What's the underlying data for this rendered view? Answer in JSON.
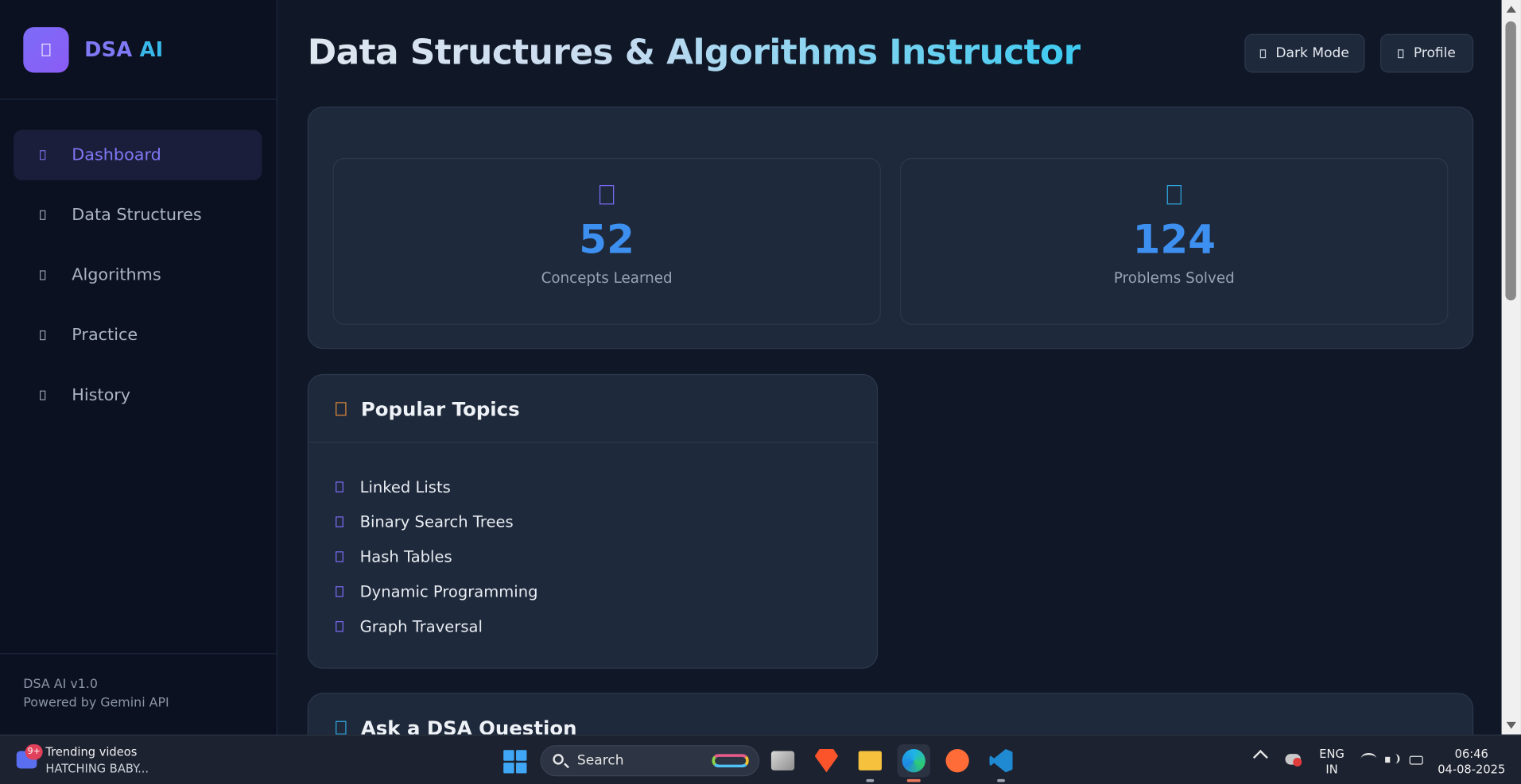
{
  "brand": {
    "name": "DSA",
    "name_accent": "AI"
  },
  "nav": {
    "items": [
      {
        "label": "Dashboard",
        "icon": "dashboard-icon",
        "active": true
      },
      {
        "label": "Data Structures",
        "icon": "data-structures-icon"
      },
      {
        "label": "Algorithms",
        "icon": "algorithms-icon"
      },
      {
        "label": "Practice",
        "icon": "practice-icon"
      },
      {
        "label": "History",
        "icon": "history-icon"
      }
    ]
  },
  "sidebar_footer": {
    "version": "DSA AI v1.0",
    "powered": "Powered by Gemini API"
  },
  "header": {
    "title": "Data Structures & Algorithms Instructor",
    "dark_mode_label": "Dark Mode",
    "profile_label": "Profile"
  },
  "stats": [
    {
      "value": "52",
      "label": "Concepts Learned",
      "icon": "brain-icon",
      "icon_color": "#7c6cf7"
    },
    {
      "value": "124",
      "label": "Problems Solved",
      "icon": "check-icon",
      "icon_color": "#2fa8e0"
    }
  ],
  "topics": {
    "title": "Popular Topics",
    "icon": "fire-icon",
    "items": [
      "Linked Lists",
      "Binary Search Trees",
      "Hash Tables",
      "Dynamic Programming",
      "Graph Traversal"
    ]
  },
  "ask": {
    "title": "Ask a DSA Question",
    "icon": "question-icon"
  },
  "taskbar": {
    "widget_badge": "9+",
    "widget_title": "Trending videos",
    "widget_subtitle": "HATCHING BABY...",
    "search_placeholder": "Search",
    "lang_top": "ENG",
    "lang_bottom": "IN",
    "time": "06:46",
    "date": "04-08-2025",
    "apps": [
      "task-view",
      "brave",
      "file-explorer",
      "edge",
      "postman",
      "vscode"
    ]
  },
  "colors": {
    "accent": "#7c6cf7",
    "stat_number": "#3d8ff0",
    "card_bg": "#1e293b",
    "page_bg": "#101726"
  }
}
